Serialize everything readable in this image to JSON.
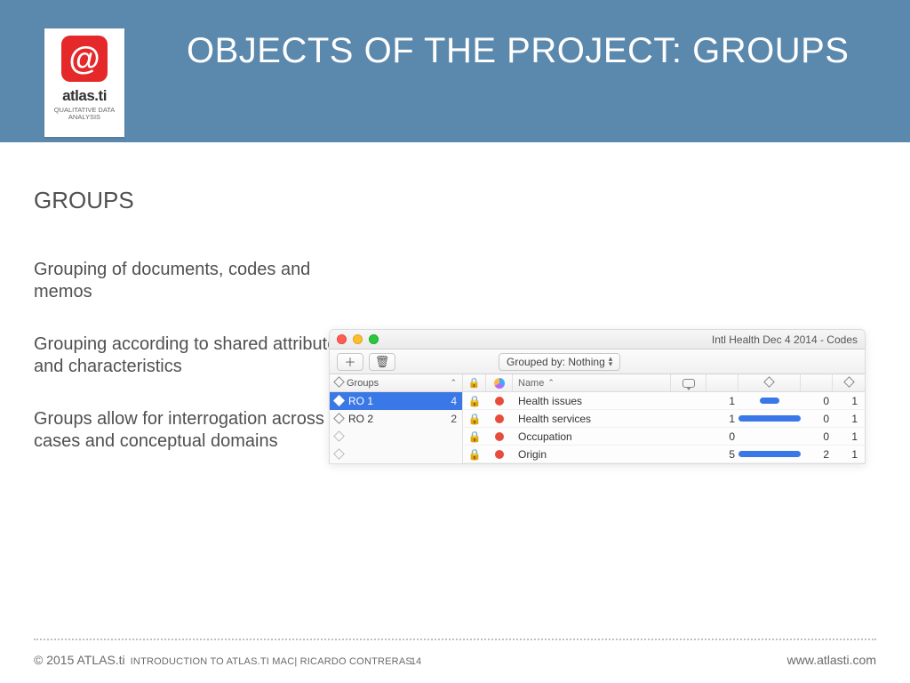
{
  "brand": {
    "at_glyph": "@",
    "name": "atlas.ti",
    "tagline": "QUALITATIVE DATA ANALYSIS"
  },
  "slide_title": "OBJECTS OF THE PROJECT: GROUPS",
  "section_heading": "GROUPS",
  "bullets": [
    "Grouping of documents, codes and memos",
    "Grouping according to shared attributes and characteristics",
    "Groups allow for interrogation across cases and conceptual domains"
  ],
  "mac": {
    "window_title": "Intl Health Dec 4 2014 - Codes",
    "toolbar": {
      "add_glyph": "＋",
      "trash_glyph": "🗑",
      "grouped_label": "Grouped by: Nothing"
    },
    "sidebar": {
      "header": "Groups",
      "rows": [
        {
          "label": "RO 1",
          "count": "4",
          "filled": true,
          "selected": true
        },
        {
          "label": "RO 2",
          "count": "2",
          "filled": false,
          "selected": false
        }
      ]
    },
    "columns": {
      "name": "Name"
    },
    "rows": [
      {
        "name": "Health issues",
        "v1": "1",
        "bar": 22,
        "v3": "0",
        "v4": "1"
      },
      {
        "name": "Health services",
        "v1": "1",
        "bar": 70,
        "v3": "0",
        "v4": "1"
      },
      {
        "name": "Occupation",
        "v1": "0",
        "bar": 0,
        "v3": "0",
        "v4": "1"
      },
      {
        "name": "Origin",
        "v1": "5",
        "bar": 70,
        "v3": "2",
        "v4": "1"
      }
    ]
  },
  "footer": {
    "copyright": "© 2015 ATLAS.ti",
    "subtitle": "INTRODUCTION TO ATLAS.TI MAC| RICARDO CONTRERAS",
    "page": "14",
    "url": "www.atlasti.com"
  }
}
